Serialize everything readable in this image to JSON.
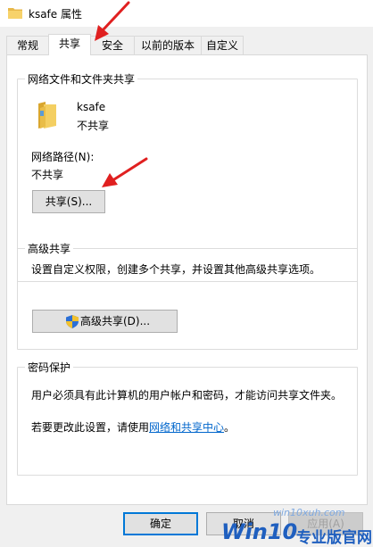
{
  "window": {
    "title": "ksafe 属性"
  },
  "tabs": [
    {
      "label": "常规"
    },
    {
      "label": "共享"
    },
    {
      "label": "安全"
    },
    {
      "label": "以前的版本"
    },
    {
      "label": "自定义"
    }
  ],
  "active_tab": "共享",
  "network_sharing": {
    "group_title": "网络文件和文件夹共享",
    "folder_name": "ksafe",
    "folder_status": "不共享",
    "path_label": "网络路径(N):",
    "path_value": "不共享",
    "share_button": "共享(S)..."
  },
  "advanced_sharing": {
    "group_title": "高级共享",
    "description": "设置自定义权限，创建多个共享，并设置其他高级共享选项。",
    "button": "高级共享(D)..."
  },
  "password_protection": {
    "group_title": "密码保护",
    "description": "用户必须具有此计算机的用户帐户和密码，才能访问共享文件夹。",
    "change_prefix": "若要更改此设置，请使用",
    "change_link": "网络和共享中心",
    "change_suffix": "。"
  },
  "footer": {
    "ok": "确定",
    "cancel": "取消",
    "apply": "应用(A)"
  },
  "watermark": {
    "url": "win10xuh.com",
    "brand": "Win10",
    "brand_suffix": "专业版官网"
  },
  "colors": {
    "accent": "#0078d7",
    "link": "#0066cc",
    "annotation_arrow": "#e02020",
    "watermark_blue": "#1f5fbf"
  }
}
